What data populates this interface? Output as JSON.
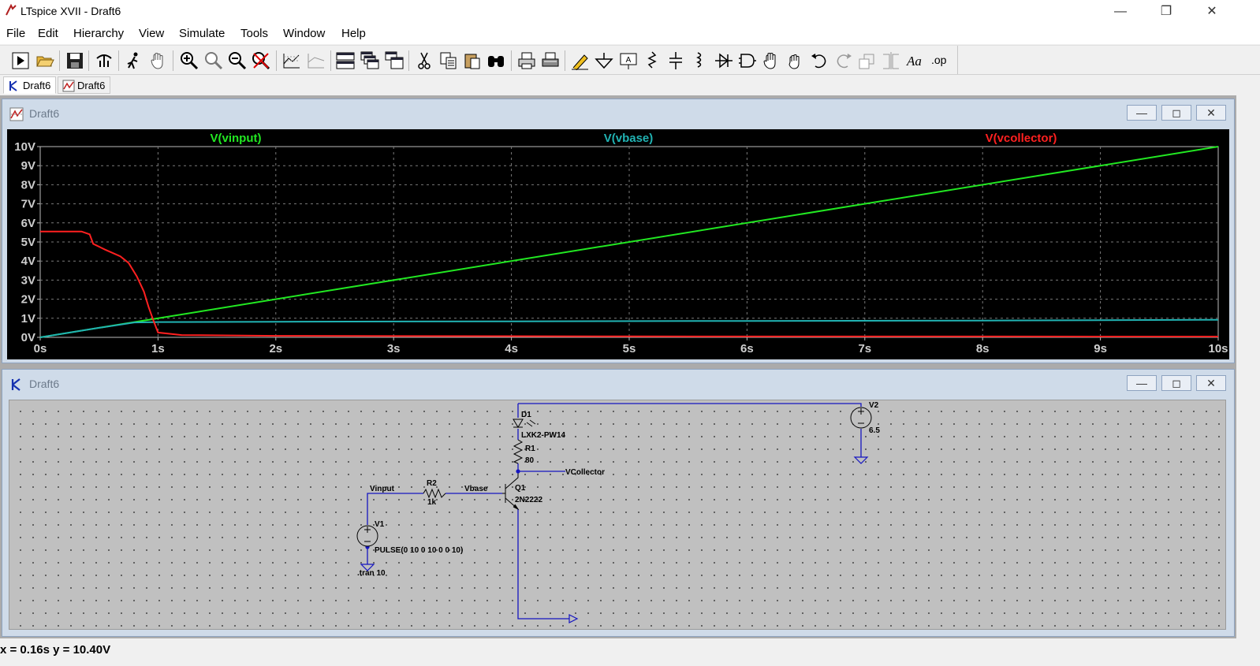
{
  "window": {
    "title": "LTspice XVII - Draft6",
    "minimize": "—",
    "maximize": "❐",
    "close": "✕"
  },
  "menu": [
    "File",
    "Edit",
    "Hierarchy",
    "View",
    "Simulate",
    "Tools",
    "Window",
    "Help"
  ],
  "toolbar_icons": [
    "run-icon",
    "open-icon",
    "save-icon",
    "control-panel-icon",
    "halt-icon",
    "pan-icon",
    "zoom-in-icon",
    "zoom-full-icon",
    "zoom-out-icon",
    "zoom-cancel-icon",
    "autorange-icon",
    "delete-trace-icon",
    "tile-horizontal-icon",
    "cascade-icon",
    "tile-vertical-icon",
    "cut-icon",
    "copy-icon",
    "paste-icon",
    "find-icon",
    "print-icon",
    "print-setup-icon",
    "wire-icon",
    "ground-icon",
    "label-net-icon",
    "resistor-icon",
    "capacitor-icon",
    "inductor-icon",
    "diode-icon",
    "component-icon",
    "move-icon",
    "drag-icon",
    "undo-icon",
    "redo-icon",
    "rotate-icon",
    "mirror-icon",
    "text-icon",
    "spice-directive-icon"
  ],
  "tabs": [
    {
      "label": "Draft6",
      "icon": "schematic-icon"
    },
    {
      "label": "Draft6",
      "icon": "waveform-icon"
    }
  ],
  "plot_window": {
    "title": "Draft6",
    "min": "—",
    "max": "◻",
    "close": "✕"
  },
  "schematic_window": {
    "title": "Draft6",
    "min": "—",
    "max": "◻",
    "close": "✕"
  },
  "chart_data": {
    "type": "line",
    "xlim": [
      0,
      10
    ],
    "ylim": [
      0,
      10
    ],
    "x_ticks": [
      "0s",
      "1s",
      "2s",
      "3s",
      "4s",
      "5s",
      "6s",
      "7s",
      "8s",
      "9s",
      "10s"
    ],
    "y_ticks": [
      "0V",
      "1V",
      "2V",
      "3V",
      "4V",
      "5V",
      "6V",
      "7V",
      "8V",
      "9V",
      "10V"
    ],
    "grid": true,
    "series": [
      {
        "name": "V(vinput)",
        "color": "#22e822",
        "x": [
          0,
          10
        ],
        "y": [
          0,
          10
        ]
      },
      {
        "name": "V(vbase)",
        "color": "#21b3b3",
        "x": [
          0,
          0.5,
          0.8,
          1,
          2,
          4,
          6,
          8,
          10
        ],
        "y": [
          0,
          0.5,
          0.78,
          0.8,
          0.82,
          0.84,
          0.86,
          0.88,
          0.92
        ]
      },
      {
        "name": "V(vcollector)",
        "color": "#ff2020",
        "x": [
          0,
          0.35,
          0.42,
          0.45,
          0.55,
          0.68,
          0.75,
          0.82,
          0.88,
          0.92,
          0.96,
          1.0,
          1.2,
          2,
          5,
          10
        ],
        "y": [
          5.55,
          5.55,
          5.4,
          4.9,
          4.6,
          4.25,
          3.9,
          3.2,
          2.4,
          1.6,
          0.9,
          0.25,
          0.12,
          0.08,
          0.05,
          0.04
        ]
      }
    ]
  },
  "schematic": {
    "labels": {
      "d1_name": "D1",
      "d1_value": "LXK2-PW14",
      "r1_name": "R1",
      "r1_value": "80",
      "r2_name": "R2",
      "r2_value": "1k",
      "q1_name": "Q1",
      "q1_value": "2N2222",
      "v1_name": "V1",
      "v1_value": "PULSE(0 10 0 10 0 0 10)",
      "v2_name": "V2",
      "v2_value": "6.5",
      "net_vinput": "Vinput",
      "net_vbase": "Vbase",
      "net_vcollector": "VCollector",
      "directive": ".tran 10"
    },
    "wire_color": "#1515c0"
  },
  "status": {
    "text": "x = 0.16s   y = 10.40V"
  }
}
